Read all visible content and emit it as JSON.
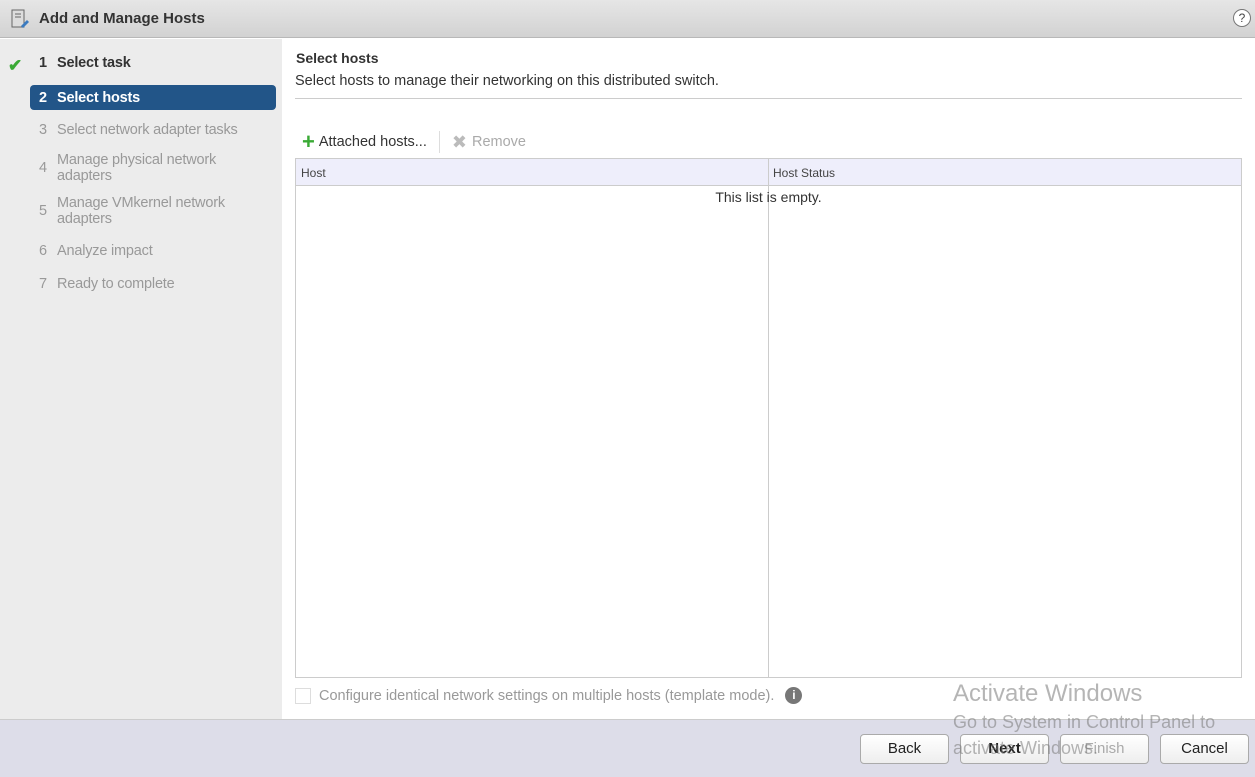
{
  "window": {
    "title": "Add and Manage Hosts",
    "help": "?"
  },
  "steps": [
    {
      "num": "1",
      "label": "Select task",
      "state": "done"
    },
    {
      "num": "2",
      "label": "Select hosts",
      "state": "active"
    },
    {
      "num": "3",
      "label": "Select network adapter tasks"
    },
    {
      "num": "4",
      "label": "Manage physical network adapters"
    },
    {
      "num": "5",
      "label": "Manage VMkernel network adapters"
    },
    {
      "num": "6",
      "label": "Analyze impact"
    },
    {
      "num": "7",
      "label": "Ready to complete"
    }
  ],
  "main": {
    "title": "Select hosts",
    "subtitle": "Select hosts to manage their networking on this distributed switch.",
    "toolbar": {
      "attach": "Attached hosts...",
      "remove": "Remove"
    },
    "columns": [
      "Host",
      "Host Status"
    ],
    "empty": "This list is empty.",
    "template_mode": "Configure identical network settings on multiple hosts (template mode)."
  },
  "footer": {
    "back": "Back",
    "next": "Next",
    "finish": "Finish",
    "cancel": "Cancel"
  },
  "watermark": {
    "title": "Activate Windows",
    "sub": "Go to System in Control Panel to",
    "sub2": "activate Windows."
  }
}
